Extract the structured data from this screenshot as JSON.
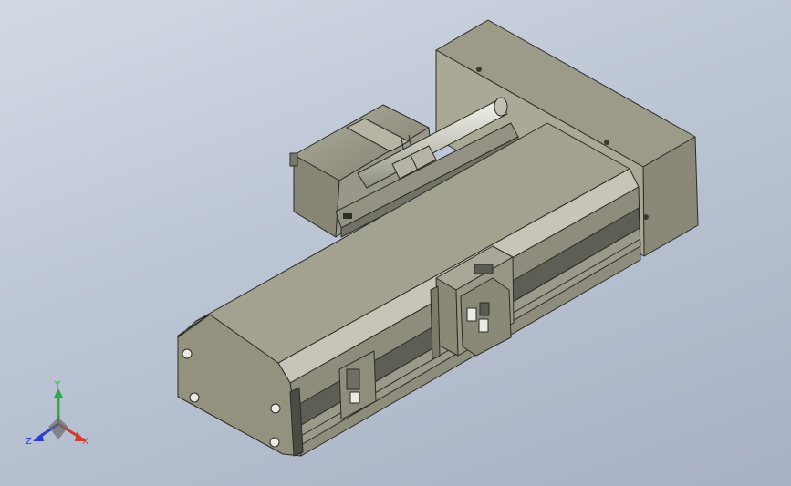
{
  "viewport": {
    "background_top": "#d3d9e4",
    "background_bottom": "#a7b1c4",
    "model": "linear-actuator-with-side-mounted-motor"
  },
  "colors": {
    "body_top": "#a2a190",
    "body_side": "#8f8e7e",
    "body_dark": "#6f6e62",
    "edge": "#2c2b26",
    "shaft": "#d8d8d0"
  },
  "triad": {
    "x_label": "X",
    "y_label": "Y",
    "z_label": "Z",
    "x_color": "#d23a2a",
    "y_color": "#2fa84a",
    "z_color": "#2a3fd2"
  }
}
